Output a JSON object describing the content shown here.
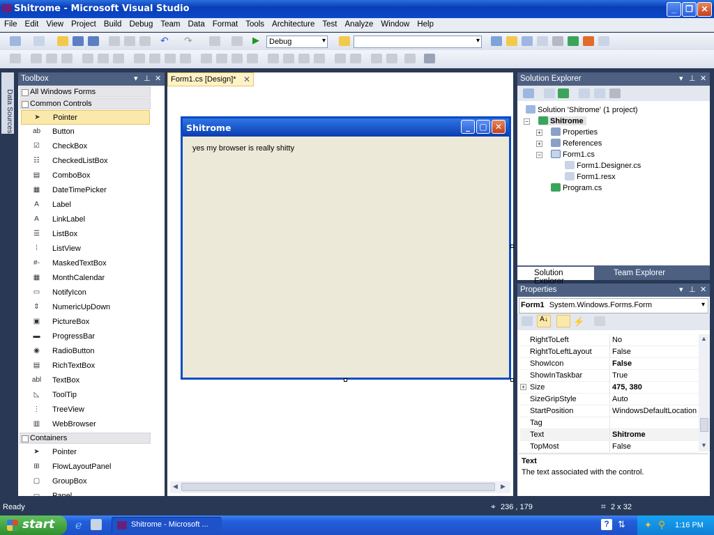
{
  "window": {
    "title": "Shitrome - Microsoft Visual Studio"
  },
  "menu": [
    "File",
    "Edit",
    "View",
    "Project",
    "Build",
    "Debug",
    "Team",
    "Data",
    "Format",
    "Tools",
    "Architecture",
    "Test",
    "Analyze",
    "Window",
    "Help"
  ],
  "toolbar": {
    "config_value": "Debug",
    "platform_value": ""
  },
  "left_strip": {
    "data_sources_label": "Data Sources"
  },
  "toolbox": {
    "title": "Toolbox",
    "category_all": "All Windows Forms",
    "category_common": "Common Controls",
    "common_items": [
      {
        "label": "Pointer",
        "icon": "pointer-icon",
        "glyph": "➤"
      },
      {
        "label": "Button",
        "icon": "button-icon",
        "glyph": "ab"
      },
      {
        "label": "CheckBox",
        "icon": "checkbox-icon",
        "glyph": "☑"
      },
      {
        "label": "CheckedListBox",
        "icon": "checkedlistbox-icon",
        "glyph": "☷"
      },
      {
        "label": "ComboBox",
        "icon": "combobox-icon",
        "glyph": "▤"
      },
      {
        "label": "DateTimePicker",
        "icon": "datetimepicker-icon",
        "glyph": "▦"
      },
      {
        "label": "Label",
        "icon": "label-icon",
        "glyph": "A"
      },
      {
        "label": "LinkLabel",
        "icon": "linklabel-icon",
        "glyph": "A"
      },
      {
        "label": "ListBox",
        "icon": "listbox-icon",
        "glyph": "☰"
      },
      {
        "label": "ListView",
        "icon": "listview-icon",
        "glyph": "⁞"
      },
      {
        "label": "MaskedTextBox",
        "icon": "maskedtextbox-icon",
        "glyph": "#-"
      },
      {
        "label": "MonthCalendar",
        "icon": "monthcalendar-icon",
        "glyph": "▦"
      },
      {
        "label": "NotifyIcon",
        "icon": "notifyicon-icon",
        "glyph": "▭"
      },
      {
        "label": "NumericUpDown",
        "icon": "numericupdown-icon",
        "glyph": "⇕"
      },
      {
        "label": "PictureBox",
        "icon": "picturebox-icon",
        "glyph": "▣"
      },
      {
        "label": "ProgressBar",
        "icon": "progressbar-icon",
        "glyph": "▬"
      },
      {
        "label": "RadioButton",
        "icon": "radiobutton-icon",
        "glyph": "◉"
      },
      {
        "label": "RichTextBox",
        "icon": "richtextbox-icon",
        "glyph": "▤"
      },
      {
        "label": "TextBox",
        "icon": "textbox-icon",
        "glyph": "abl"
      },
      {
        "label": "ToolTip",
        "icon": "tooltip-icon",
        "glyph": "◺"
      },
      {
        "label": "TreeView",
        "icon": "treeview-icon",
        "glyph": "⋮"
      },
      {
        "label": "WebBrowser",
        "icon": "webbrowser-icon",
        "glyph": "▥"
      }
    ],
    "category_containers": "Containers",
    "container_items": [
      {
        "label": "Pointer",
        "icon": "pointer-icon",
        "glyph": "➤"
      },
      {
        "label": "FlowLayoutPanel",
        "icon": "flowlayoutpanel-icon",
        "glyph": "⊞"
      },
      {
        "label": "GroupBox",
        "icon": "groupbox-icon",
        "glyph": "▢"
      },
      {
        "label": "Panel",
        "icon": "panel-icon",
        "glyph": "▭"
      }
    ]
  },
  "designer": {
    "tab_label": "Form1.cs [Design]*",
    "form_title": "Shitrome",
    "form_text": "yes my browser is really shitty"
  },
  "solution_explorer": {
    "title": "Solution Explorer",
    "solution": "Solution 'Shitrome' (1 project)",
    "project": "Shitrome",
    "nodes": [
      "Properties",
      "References",
      "Form1.cs",
      "Form1.Designer.cs",
      "Form1.resx",
      "Program.cs"
    ],
    "tab_solution": "Solution Explorer",
    "tab_team": "Team Explorer"
  },
  "properties": {
    "title": "Properties",
    "object_name": "Form1",
    "object_type": "System.Windows.Forms.Form",
    "rows": [
      {
        "name": "RightToLeft",
        "value": "No",
        "bold": false
      },
      {
        "name": "RightToLeftLayout",
        "value": "False",
        "bold": false
      },
      {
        "name": "ShowIcon",
        "value": "False",
        "bold": true
      },
      {
        "name": "ShowInTaskbar",
        "value": "True",
        "bold": false
      },
      {
        "name": "Size",
        "value": "475, 380",
        "bold": true
      },
      {
        "name": "SizeGripStyle",
        "value": "Auto",
        "bold": false
      },
      {
        "name": "StartPosition",
        "value": "WindowsDefaultLocation",
        "bold": false
      },
      {
        "name": "Tag",
        "value": "",
        "bold": false
      },
      {
        "name": "Text",
        "value": "Shitrome",
        "bold": true
      },
      {
        "name": "TopMost",
        "value": "False",
        "bold": false
      }
    ],
    "desc_title": "Text",
    "desc_text": "The text associated with the control."
  },
  "status": {
    "text": "Ready",
    "position": "236 , 179",
    "size": "2 x 32"
  },
  "taskbar": {
    "start_label": "start",
    "task_label": "Shitrome - Microsoft ...",
    "clock": "1:16 PM"
  },
  "colors": {
    "accent": "#4d6082",
    "selection": "#fbe9ab",
    "form_title": "#0a3cb0"
  }
}
